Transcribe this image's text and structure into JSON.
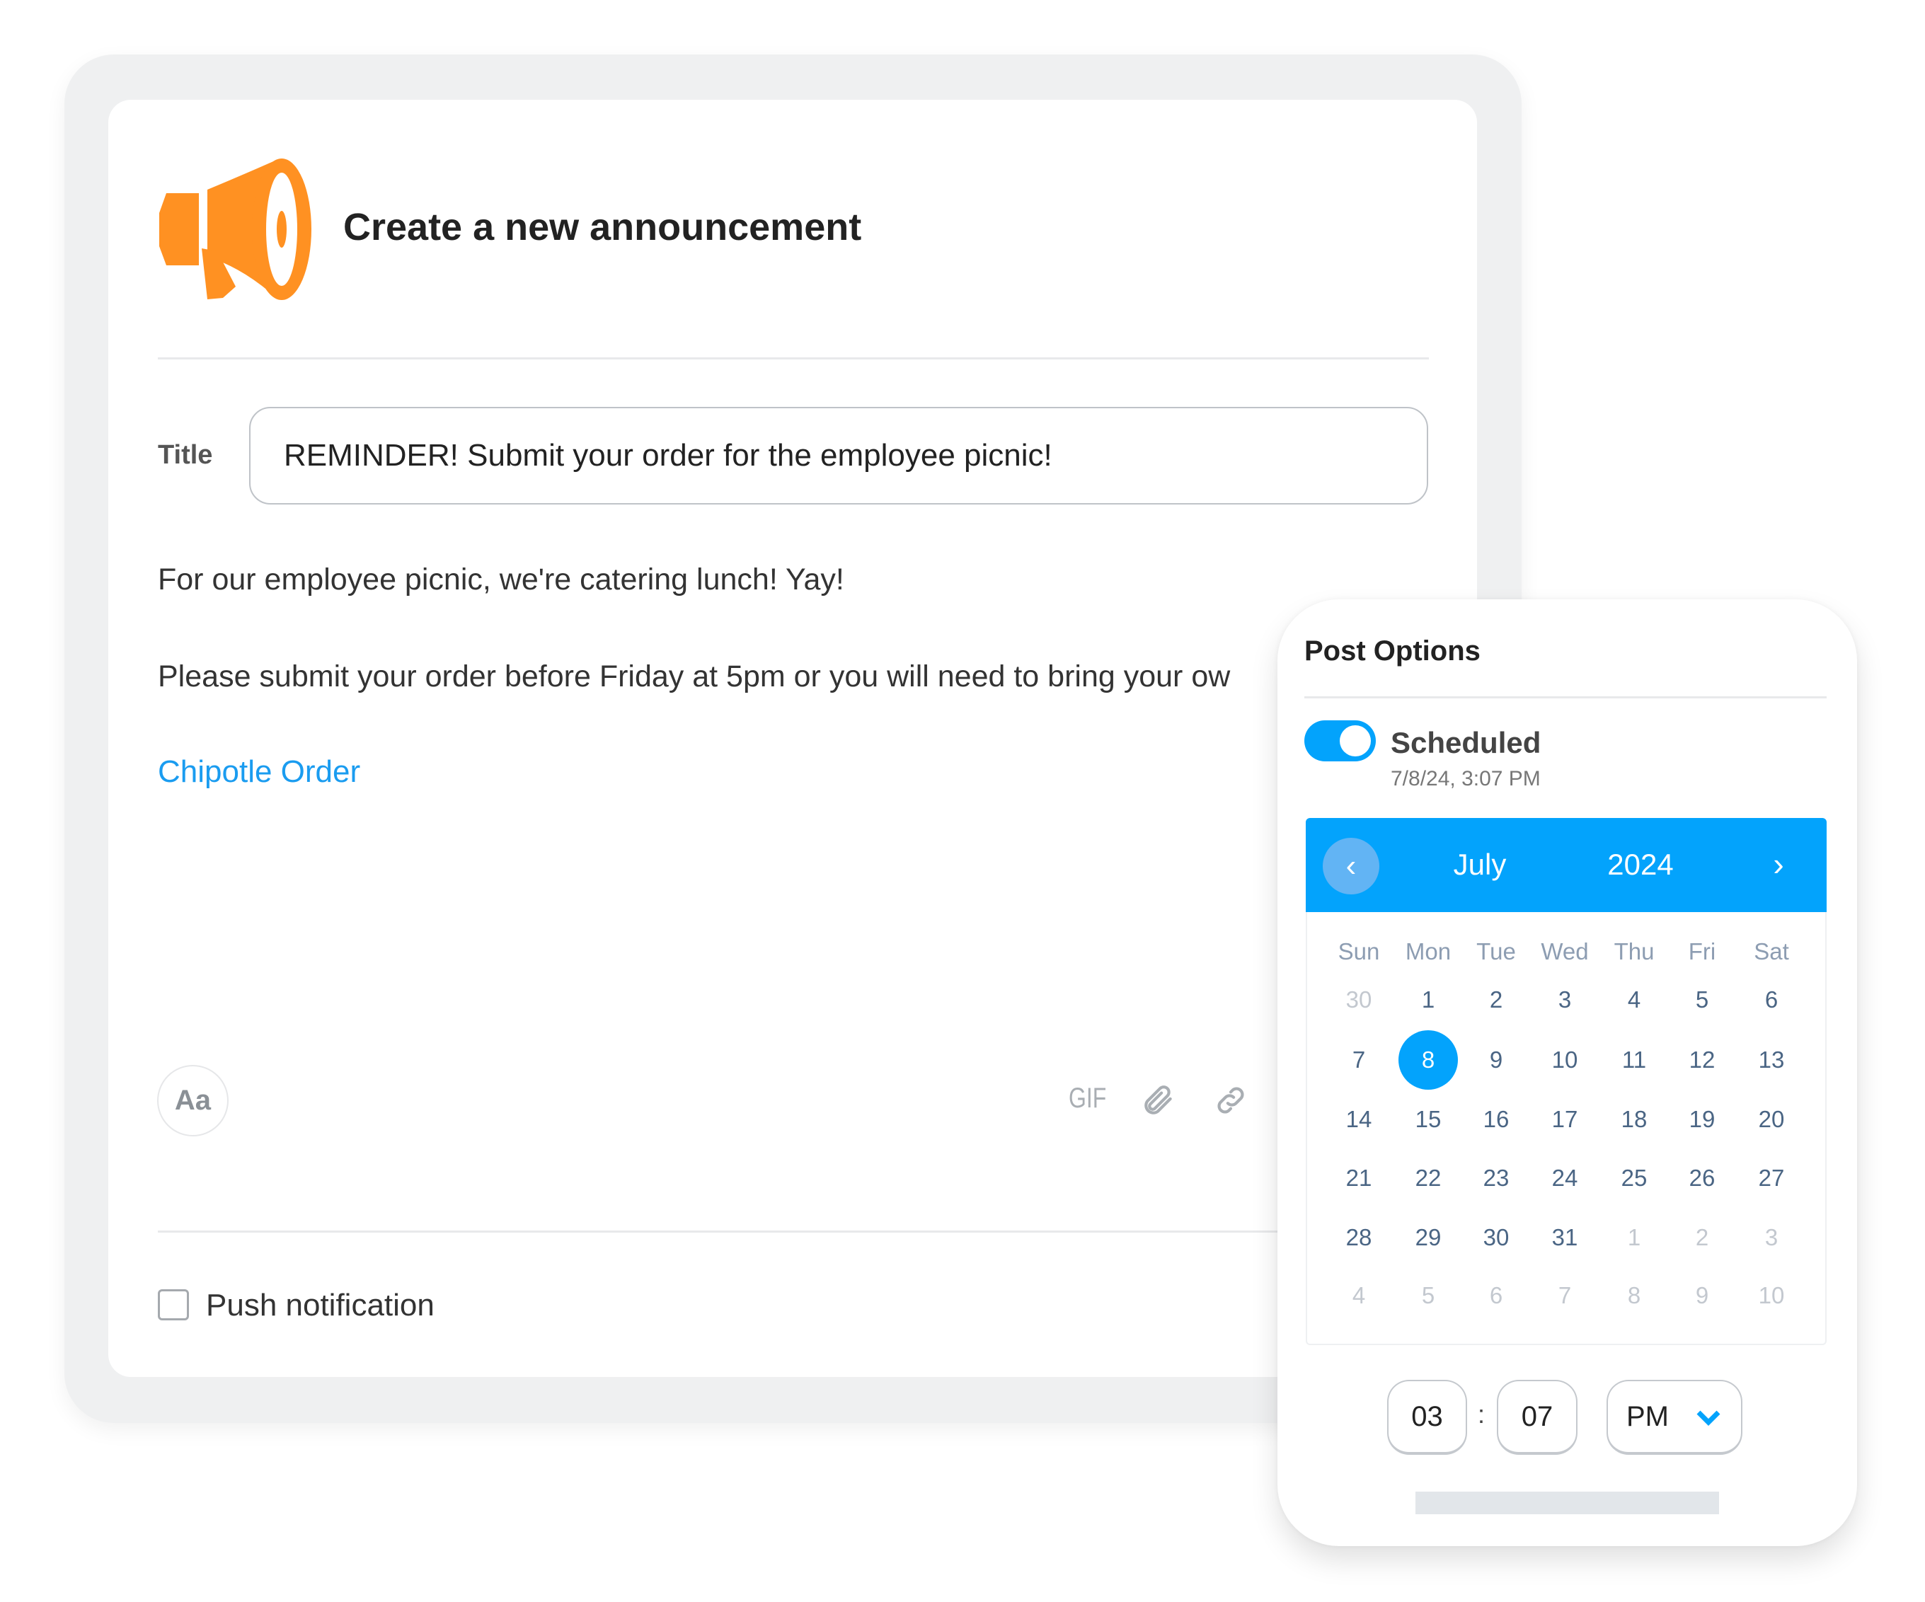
{
  "announcement": {
    "title": "Create a new announcement",
    "title_label": "Title",
    "title_value": "REMINDER! Submit your order for the employee picnic!",
    "body_lines": [
      "For our employee picnic, we're catering lunch! Yay!",
      "Please submit your order before Friday at 5pm or you will need to bring your ow"
    ],
    "link_text": "Chipotle Order",
    "format_button": "Aa",
    "gif_button": "GIF",
    "attach_icon": "paperclip-icon",
    "link_icon": "chain-link-icon",
    "push_label": "Push notification",
    "push_checked": false,
    "brand_color": "#ff9122",
    "link_color": "#1a9cf0"
  },
  "post_options": {
    "heading": "Post Options",
    "scheduled_label": "Scheduled",
    "scheduled_on": true,
    "scheduled_datetime": "7/8/24, 3:07 PM",
    "accent": "#03a3fc",
    "calendar": {
      "month": "July",
      "year": "2024",
      "prev": "‹",
      "next": "›",
      "weekdays": [
        "Sun",
        "Mon",
        "Tue",
        "Wed",
        "Thu",
        "Fri",
        "Sat"
      ],
      "selected": "8",
      "weeks": [
        [
          [
            "30",
            true
          ],
          [
            "1",
            false
          ],
          [
            "2",
            false
          ],
          [
            "3",
            false
          ],
          [
            "4",
            false
          ],
          [
            "5",
            false
          ],
          [
            "6",
            false
          ]
        ],
        [
          [
            "7",
            false
          ],
          [
            "8",
            false
          ],
          [
            "9",
            false
          ],
          [
            "10",
            false
          ],
          [
            "11",
            false
          ],
          [
            "12",
            false
          ],
          [
            "13",
            false
          ]
        ],
        [
          [
            "14",
            false
          ],
          [
            "15",
            false
          ],
          [
            "16",
            false
          ],
          [
            "17",
            false
          ],
          [
            "18",
            false
          ],
          [
            "19",
            false
          ],
          [
            "20",
            false
          ]
        ],
        [
          [
            "21",
            false
          ],
          [
            "22",
            false
          ],
          [
            "23",
            false
          ],
          [
            "24",
            false
          ],
          [
            "25",
            false
          ],
          [
            "26",
            false
          ],
          [
            "27",
            false
          ]
        ],
        [
          [
            "28",
            false
          ],
          [
            "29",
            false
          ],
          [
            "30",
            false
          ],
          [
            "31",
            false
          ],
          [
            "1",
            true
          ],
          [
            "2",
            true
          ],
          [
            "3",
            true
          ]
        ],
        [
          [
            "4",
            true
          ],
          [
            "5",
            true
          ],
          [
            "6",
            true
          ],
          [
            "7",
            true
          ],
          [
            "8",
            true
          ],
          [
            "9",
            true
          ],
          [
            "10",
            true
          ]
        ]
      ]
    },
    "time": {
      "hour": "03",
      "separator": ":",
      "minute": "07",
      "period": "PM"
    }
  }
}
